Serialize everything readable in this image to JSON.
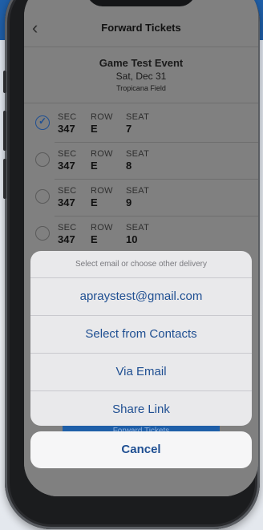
{
  "nav": {
    "title": "Forward Tickets"
  },
  "event": {
    "name": "Game Test Event",
    "date": "Sat, Dec 31",
    "venue": "Tropicana Field"
  },
  "column_labels": {
    "sec": "SEC",
    "row": "ROW",
    "seat": "SEAT"
  },
  "tickets": [
    {
      "sec": "347",
      "row": "E",
      "seat": "7",
      "selected": true
    },
    {
      "sec": "347",
      "row": "E",
      "seat": "8",
      "selected": false
    },
    {
      "sec": "347",
      "row": "E",
      "seat": "9",
      "selected": false
    },
    {
      "sec": "347",
      "row": "E",
      "seat": "10",
      "selected": false
    }
  ],
  "action_sheet": {
    "header": "Select email or choose other delivery",
    "options": [
      "apraystest@gmail.com",
      "Select from Contacts",
      "Via Email",
      "Share Link"
    ],
    "cancel": "Cancel"
  },
  "background_button": {
    "label": "Forward Tickets"
  },
  "colors": {
    "accent": "#1f4f92",
    "brand_blue": "#1f5fa8",
    "overlay": "#808080"
  }
}
